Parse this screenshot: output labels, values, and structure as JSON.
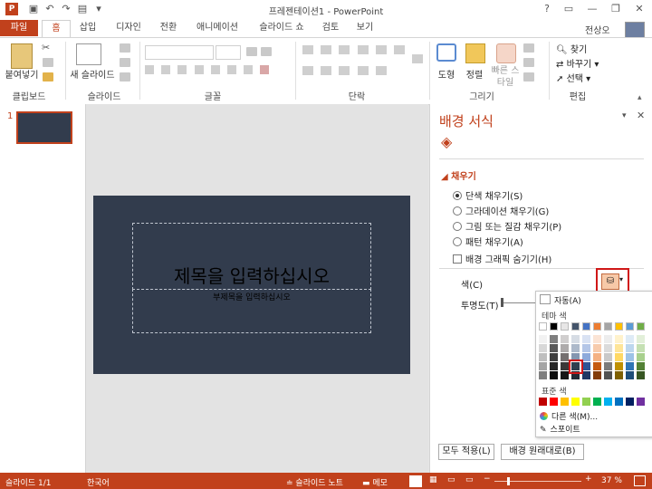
{
  "window": {
    "title": "프레젠테이션1 - PowerPoint",
    "minimize": "—",
    "restore": "❐",
    "close": "✕",
    "help": "?"
  },
  "tabs": [
    "파일",
    "홈",
    "삽입",
    "디자인",
    "전환",
    "애니메이션",
    "슬라이드 쇼",
    "검토",
    "보기"
  ],
  "user": "전상오",
  "ribbon": {
    "clipboard": {
      "paste": "붙여넣기",
      "label": "클립보드"
    },
    "slides": {
      "new_slide": "새 슬라이드",
      "label": "슬라이드"
    },
    "font": {
      "label": "글꼴"
    },
    "paragraph": {
      "label": "단락"
    },
    "drawing": {
      "shapes": "도형",
      "arrange": "정렬",
      "quick_styles": "빠른 스타일",
      "label": "그리기"
    },
    "editing": {
      "find": "찾기",
      "replace": "바꾸기",
      "select": "선택",
      "label": "편집"
    }
  },
  "thumbnail": {
    "number": "1"
  },
  "slide": {
    "title_placeholder": "제목을 입력하십시오",
    "subtitle_placeholder": "부제목을 입력하십시오"
  },
  "pane": {
    "title": "배경 서식",
    "section": "채우기",
    "options": [
      "단색 채우기(S)",
      "그라데이션 채우기(G)",
      "그림 또는 질감 채우기(P)",
      "패턴 채우기(A)"
    ],
    "hide_graphics": "배경 그래픽 숨기기(H)",
    "color_label": "색(C)",
    "transparency_label": "투명도(T)",
    "apply_all": "모두 적용(L)",
    "reset": "배경 원래대로(B)"
  },
  "color_menu": {
    "auto": "자동(A)",
    "theme_header": "테마 색",
    "standard_header": "표준 색",
    "more_colors": "다른 색(M)...",
    "eyedropper": "스포이트",
    "theme_colors": [
      "#ffffff",
      "#000000",
      "#e7e6e6",
      "#44546a",
      "#4472c4",
      "#ed7d31",
      "#a5a5a5",
      "#ffc000",
      "#5b9bd5",
      "#70ad47"
    ],
    "theme_shades": [
      [
        "#f2f2f2",
        "#7f7f7f",
        "#d0cece",
        "#d6dce4",
        "#d9e2f3",
        "#fbe4d5",
        "#ededed",
        "#fff2cc",
        "#deebf6",
        "#e2efd9"
      ],
      [
        "#d8d8d8",
        "#595959",
        "#aeabab",
        "#adb9ca",
        "#b4c6e7",
        "#f7cbac",
        "#dbdbdb",
        "#fee599",
        "#bdd7ee",
        "#c5e0b3"
      ],
      [
        "#bfbfbf",
        "#3f3f3f",
        "#757070",
        "#8496b0",
        "#8eaadb",
        "#f4b183",
        "#c9c9c9",
        "#ffd965",
        "#9dc3e6",
        "#a8d08d"
      ],
      [
        "#a5a5a5",
        "#262626",
        "#3a3838",
        "#323f4f",
        "#2f5496",
        "#c55a11",
        "#7b7b7b",
        "#bf9000",
        "#2e75b5",
        "#538135"
      ],
      [
        "#7f7f7f",
        "#0c0c0c",
        "#171616",
        "#222a35",
        "#1f3864",
        "#833c0b",
        "#525252",
        "#7f6000",
        "#1e4e79",
        "#375623"
      ]
    ],
    "standard_colors": [
      "#c00000",
      "#ff0000",
      "#ffc000",
      "#ffff00",
      "#92d050",
      "#00b050",
      "#00b0f0",
      "#0070c0",
      "#002060",
      "#7030a0"
    ]
  },
  "status": {
    "slide_count": "슬라이드 1/1",
    "language": "한국어",
    "notes": "슬라이드 노트",
    "comments": "메모",
    "zoom": "37 %"
  },
  "colors": {
    "accent": "#c1411c",
    "slide_bg": "#323c4d"
  }
}
